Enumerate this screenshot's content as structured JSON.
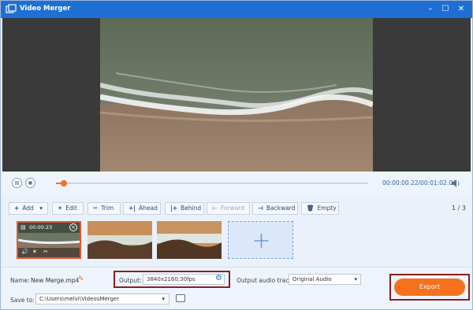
{
  "window": {
    "title": "Video Merger",
    "minimize": "–",
    "maximize": "☐",
    "close": "✕"
  },
  "player": {
    "time": "00:00:00.22/00:01:02.06",
    "progress": 0.02
  },
  "toolbar": {
    "add": "Add",
    "edit": "Edit",
    "trim": "Trim",
    "ahead": "Ahead",
    "behind": "Behind",
    "forward": "Forward",
    "backward": "Backward",
    "empty": "Empty",
    "counter": "1 / 3"
  },
  "clips": [
    {
      "duration": "00:00:23",
      "selected": true
    },
    {
      "selected": false
    },
    {
      "selected": false
    }
  ],
  "output": {
    "name_label": "Name:",
    "name_value": "New Merge.mp4",
    "output_label": "Output:",
    "output_value": "3840x2160;30fps",
    "audio_label": "Output audio track:",
    "audio_value": "Original Audio",
    "save_label": "Save to:",
    "save_value": "C:\\Users\\melvi\\VideosMerger",
    "export_label": "Export"
  },
  "colors": {
    "accent": "#f6711c",
    "titlebar": "#1e6fd3",
    "highlight": "#8a1f1f"
  }
}
